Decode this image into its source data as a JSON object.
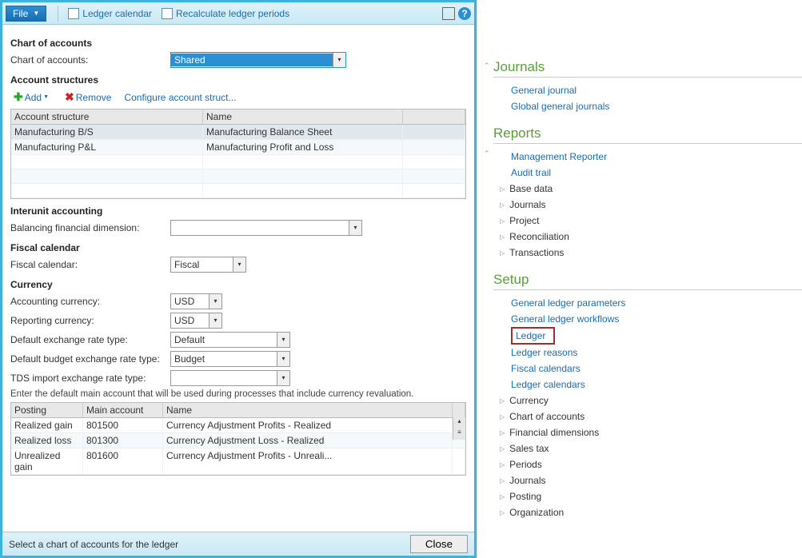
{
  "toolbar": {
    "file": "File",
    "ledger_calendar": "Ledger calendar",
    "recalculate": "Recalculate ledger periods"
  },
  "chart_of_accounts": {
    "title": "Chart of accounts",
    "label": "Chart of accounts:",
    "value": "Shared"
  },
  "account_structures": {
    "title": "Account structures",
    "add": "Add",
    "remove": "Remove",
    "configure": "Configure account struct...",
    "columns": [
      "Account structure",
      "Name"
    ],
    "rows": [
      {
        "structure": "Manufacturing B/S",
        "name": "Manufacturing Balance Sheet"
      },
      {
        "structure": "Manufacturing P&L",
        "name": "Manufacturing Profit and Loss"
      }
    ]
  },
  "interunit": {
    "title": "Interunit accounting",
    "balancing_label": "Balancing financial dimension:",
    "balancing_value": ""
  },
  "fiscal": {
    "title": "Fiscal calendar",
    "label": "Fiscal calendar:",
    "value": "Fiscal"
  },
  "currency": {
    "title": "Currency",
    "accounting_label": "Accounting currency:",
    "accounting_value": "USD",
    "reporting_label": "Reporting currency:",
    "reporting_value": "USD",
    "default_rate_label": "Default exchange rate type:",
    "default_rate_value": "Default",
    "budget_rate_label": "Default budget exchange rate type:",
    "budget_rate_value": "Budget",
    "tds_rate_label": "TDS import exchange rate type:",
    "tds_rate_value": "",
    "note": "Enter the default main account that will be used during processes that include currency revaluation.",
    "posting_columns": [
      "Posting",
      "Main account",
      "Name"
    ],
    "posting_rows": [
      {
        "posting": "Realized gain",
        "account": "801500",
        "name": "Currency Adjustment Profits - Realized"
      },
      {
        "posting": "Realized loss",
        "account": "801300",
        "name": "Currency Adjustment Loss - Realized"
      },
      {
        "posting": "Unrealized gain",
        "account": "801600",
        "name": "Currency Adjustment Profits - Unreali..."
      }
    ]
  },
  "status": {
    "text": "Select a chart of accounts for the ledger",
    "close": "Close"
  },
  "nav": {
    "journals": {
      "title": "Journals",
      "links": [
        "General journal",
        "Global general journals"
      ]
    },
    "reports": {
      "title": "Reports",
      "links": [
        "Management Reporter",
        "Audit trail"
      ],
      "expands": [
        "Base data",
        "Journals",
        "Project",
        "Reconciliation",
        "Transactions"
      ]
    },
    "setup": {
      "title": "Setup",
      "links": [
        "General ledger parameters",
        "General ledger workflows",
        "Ledger",
        "Ledger reasons",
        "Fiscal calendars",
        "Ledger calendars"
      ],
      "expands": [
        "Currency",
        "Chart of accounts",
        "Financial dimensions",
        "Sales tax",
        "Periods",
        "Journals",
        "Posting",
        "Organization"
      ]
    }
  }
}
